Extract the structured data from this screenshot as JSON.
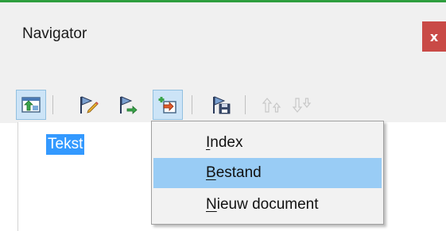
{
  "window": {
    "title": "Navigator",
    "close_label": "x",
    "accent_color": "#2e9e3e",
    "close_color": "#c94a46"
  },
  "toolbar": {
    "buttons": [
      {
        "name": "toggle-navigator-icon",
        "pressed": false,
        "enabled": true
      },
      {
        "name": "edit-flag-icon",
        "pressed": false,
        "enabled": true
      },
      {
        "name": "flag-arrow-icon",
        "pressed": false,
        "enabled": true
      },
      {
        "name": "insert-icon",
        "pressed": true,
        "enabled": true
      },
      {
        "name": "save-document-icon",
        "pressed": false,
        "enabled": true
      },
      {
        "name": "move-up-icon",
        "pressed": false,
        "enabled": false
      },
      {
        "name": "move-down-icon",
        "pressed": false,
        "enabled": false
      }
    ]
  },
  "tree": {
    "items": [
      {
        "label": "Tekst",
        "selected": true
      }
    ]
  },
  "context_menu": {
    "items": [
      {
        "accel": "I",
        "rest": "ndex",
        "highlighted": false
      },
      {
        "accel": "B",
        "rest": "estand",
        "highlighted": true
      },
      {
        "accel": "N",
        "rest": "ieuw document",
        "highlighted": false
      }
    ]
  }
}
